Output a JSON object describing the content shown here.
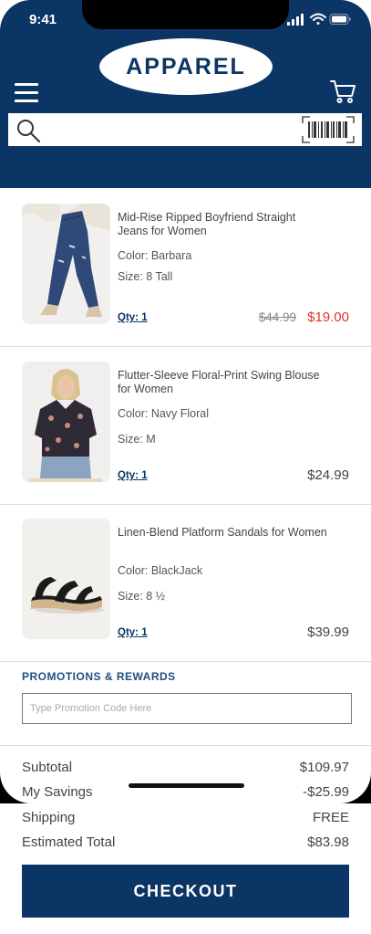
{
  "status_bar": {
    "time": "9:41"
  },
  "header": {
    "logo_text": "APPAREL"
  },
  "search": {
    "placeholder": ""
  },
  "items": [
    {
      "title": "Mid-Rise Ripped Boyfriend Straight Jeans for Women",
      "color": "Color: Barbara",
      "size": "Size: 8 Tall",
      "qty": "Qty: 1",
      "original_price": "$44.99",
      "price": "$19.00"
    },
    {
      "title": "Flutter-Sleeve Floral-Print Swing Blouse for Women",
      "color": "Color: Navy Floral",
      "size": "Size: M",
      "qty": "Qty: 1",
      "price": "$24.99"
    },
    {
      "title": "Linen-Blend Platform Sandals for Women",
      "color": "Color: BlackJack",
      "size": "Size: 8 ½",
      "qty": "Qty: 1",
      "price": "$39.99"
    }
  ],
  "promotions": {
    "title": "PROMOTIONS & REWARDS",
    "placeholder": "Type Promotion Code Here"
  },
  "summary": {
    "subtotal_label": "Subtotal",
    "subtotal": "$109.97",
    "savings_label": "My Savings",
    "savings": "-$25.99",
    "shipping_label": "Shipping",
    "shipping": "FREE",
    "total_label": "Estimated Total",
    "total": "$83.98"
  },
  "checkout_label": "CHECKOUT",
  "colors": {
    "brand": "#0b3564",
    "sale": "#e0322a"
  }
}
